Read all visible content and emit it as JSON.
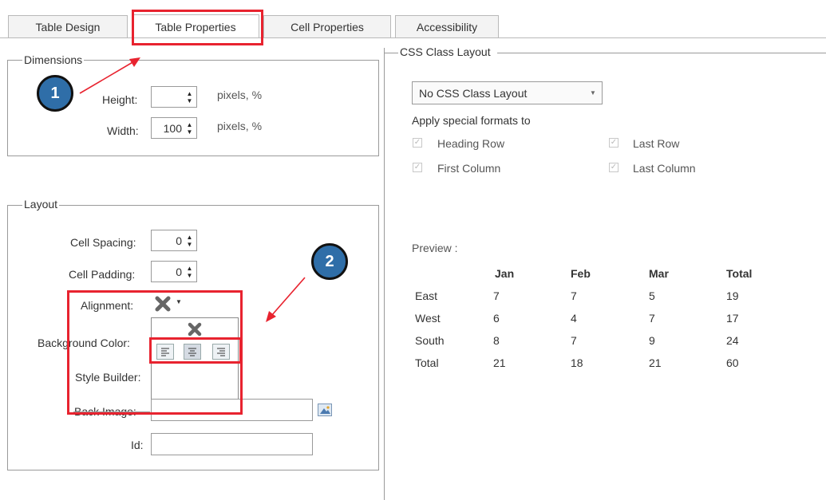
{
  "tabs": [
    {
      "label": "Table Design"
    },
    {
      "label": "Table Properties"
    },
    {
      "label": "Cell Properties"
    },
    {
      "label": "Accessibility"
    }
  ],
  "dimensions": {
    "legend": "Dimensions",
    "height_label": "Height:",
    "height_value": "",
    "height_units": "pixels, %",
    "width_label": "Width:",
    "width_value": "100",
    "width_units": "pixels, %"
  },
  "layout": {
    "legend": "Layout",
    "cell_spacing_label": "Cell Spacing:",
    "cell_spacing_value": "0",
    "cell_padding_label": "Cell Padding:",
    "cell_padding_value": "0",
    "alignment_label": "Alignment:",
    "background_color_label": "Background Color:",
    "style_builder_label": "Style Builder:",
    "back_image_label": "Back Image:",
    "back_image_value": "",
    "id_label": "Id:",
    "id_value": ""
  },
  "css_layout": {
    "legend": "CSS Class Layout",
    "select_value": "No CSS Class Layout",
    "apply_label": "Apply special formats to",
    "options": [
      {
        "label": "Heading Row",
        "checked": true
      },
      {
        "label": "Last Row",
        "checked": true
      },
      {
        "label": "First Column",
        "checked": true
      },
      {
        "label": "Last Column",
        "checked": true
      }
    ],
    "preview_label": "Preview :",
    "preview_headers": [
      "",
      "Jan",
      "Feb",
      "Mar",
      "Total"
    ],
    "preview_rows": [
      [
        "East",
        "7",
        "7",
        "5",
        "19"
      ],
      [
        "West",
        "6",
        "4",
        "7",
        "17"
      ],
      [
        "South",
        "8",
        "7",
        "9",
        "24"
      ],
      [
        "Total",
        "21",
        "18",
        "21",
        "60"
      ]
    ]
  },
  "annotations": {
    "badge1": "1",
    "badge2": "2",
    "color": "#e8232f",
    "badge_color": "#2f6ea8"
  },
  "icons": [
    "remove-x-icon",
    "dropdown-caret-icon",
    "align-left-icon",
    "align-center-icon",
    "align-right-icon",
    "image-picker-icon",
    "spinner-up-icon",
    "spinner-down-icon",
    "checkmark-icon"
  ]
}
